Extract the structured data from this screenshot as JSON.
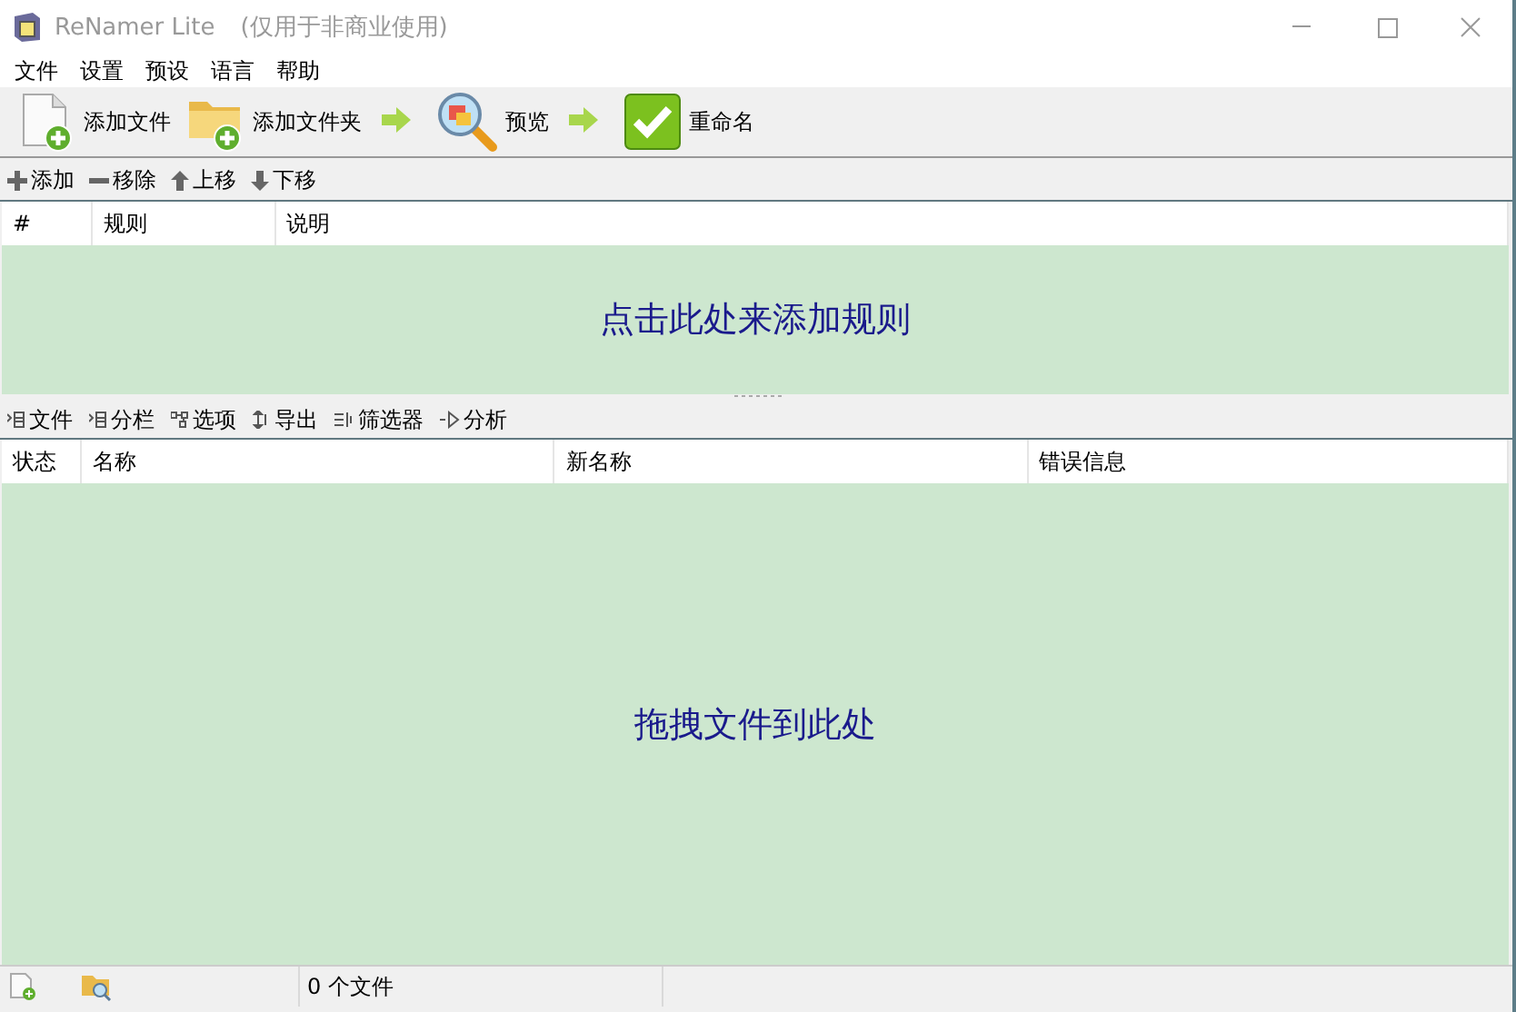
{
  "window": {
    "title": "ReNamer Lite",
    "subtitle": "(仅用于非商业使用)"
  },
  "menu": [
    "文件",
    "设置",
    "预设",
    "语言",
    "帮助"
  ],
  "toolbar": [
    {
      "kind": "add-file",
      "label": "添加文件"
    },
    {
      "kind": "add-folder",
      "label": "添加文件夹"
    },
    {
      "kind": "arrow"
    },
    {
      "kind": "preview",
      "label": "预览"
    },
    {
      "kind": "arrow"
    },
    {
      "kind": "rename",
      "label": "重命名"
    }
  ],
  "rules_toolbar": [
    {
      "kind": "plus",
      "label": "添加"
    },
    {
      "kind": "minus",
      "label": "移除"
    },
    {
      "kind": "up",
      "label": "上移"
    },
    {
      "kind": "down",
      "label": "下移"
    }
  ],
  "rules_table": {
    "columns": [
      "#",
      "规则",
      "说明"
    ],
    "empty_message": "点击此处来添加规则"
  },
  "files_toolbar": [
    {
      "kind": "columns",
      "label": "文件"
    },
    {
      "kind": "columns",
      "label": "分栏"
    },
    {
      "kind": "options",
      "label": "选项"
    },
    {
      "kind": "export",
      "label": "导出"
    },
    {
      "kind": "filter",
      "label": "筛选器"
    },
    {
      "kind": "analyze",
      "label": "分析"
    }
  ],
  "files_table": {
    "columns": [
      "状态",
      "名称",
      "新名称",
      "错误信息"
    ],
    "empty_message": "拖拽文件到此处"
  },
  "status_bar": {
    "file_count": "0 个文件"
  }
}
